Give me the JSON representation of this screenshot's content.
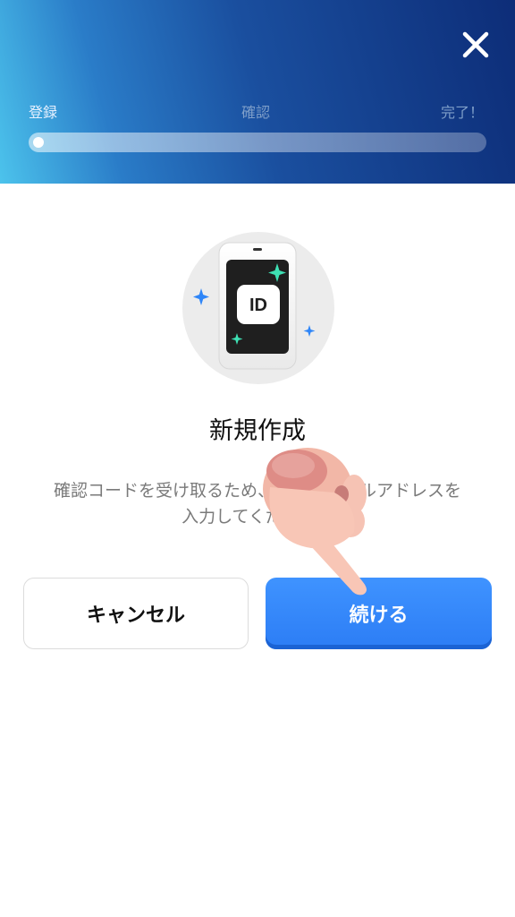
{
  "header": {
    "steps": [
      {
        "label": "登録",
        "state": "active"
      },
      {
        "label": "確認",
        "state": "inactive"
      },
      {
        "label": "完了！",
        "state": "inactive"
      }
    ],
    "progress": 0.0,
    "close_icon": "close-icon"
  },
  "hero": {
    "icon": "id-card-phone-icon",
    "badge_text": "ID"
  },
  "main": {
    "title": "新規作成",
    "description": "確認コードを受け取るため、有効なメールアドレスを入力してください。"
  },
  "buttons": {
    "cancel_label": "キャンセル",
    "continue_label": "続ける"
  },
  "colors": {
    "accent": "#2f86f8",
    "header_start": "#4cc3ec",
    "header_end": "#0d2d78"
  }
}
